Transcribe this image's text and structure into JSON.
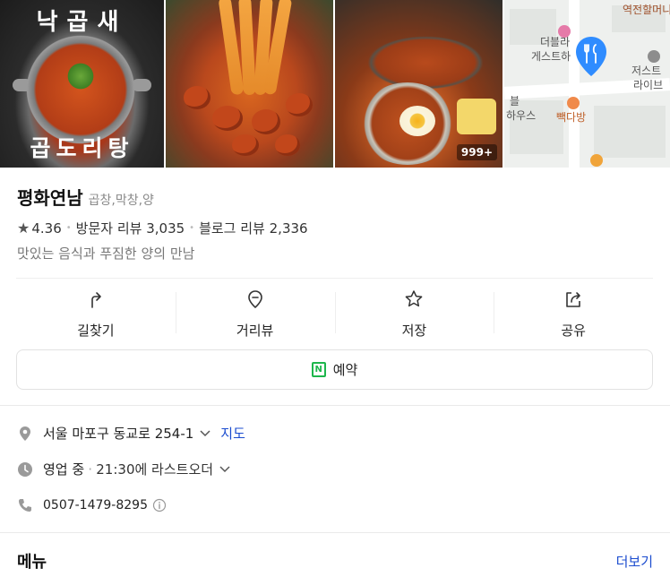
{
  "gallery": {
    "photo1_caption_top": "낙곱새",
    "photo1_caption_bottom": "곱도리탕",
    "photo_count": "999+",
    "map_labels": {
      "top_right": "역전할머니",
      "left_1": "더블라",
      "left_2": "게스트하",
      "right_1": "저스트",
      "right_2": "라이브",
      "left_3": "블",
      "left_4": "하우스",
      "cafe": "빽다방"
    }
  },
  "place": {
    "name": "평화연남",
    "category": "곱창,막창,양",
    "rating": "4.36",
    "visitor_review_label": "방문자 리뷰",
    "visitor_review_count": "3,035",
    "blog_review_label": "블로그 리뷰",
    "blog_review_count": "2,336",
    "description": "맛있는 음식과 푸짐한 양의 만남"
  },
  "actions": {
    "directions": "길찾기",
    "street_view": "거리뷰",
    "save": "저장",
    "share": "공유"
  },
  "reserve": {
    "label": "예약",
    "badge": "N"
  },
  "details": {
    "address": "서울 마포구 동교로 254-1",
    "map_link": "지도",
    "status": "영업 중",
    "last_order": "21:30에 라스트오더",
    "phone": "0507-1479-8295"
  },
  "menu": {
    "title": "메뉴",
    "more": "더보기"
  },
  "colors": {
    "link": "#1b4ccf",
    "naver_green": "#1db64c",
    "map_pin": "#2f8cff"
  }
}
